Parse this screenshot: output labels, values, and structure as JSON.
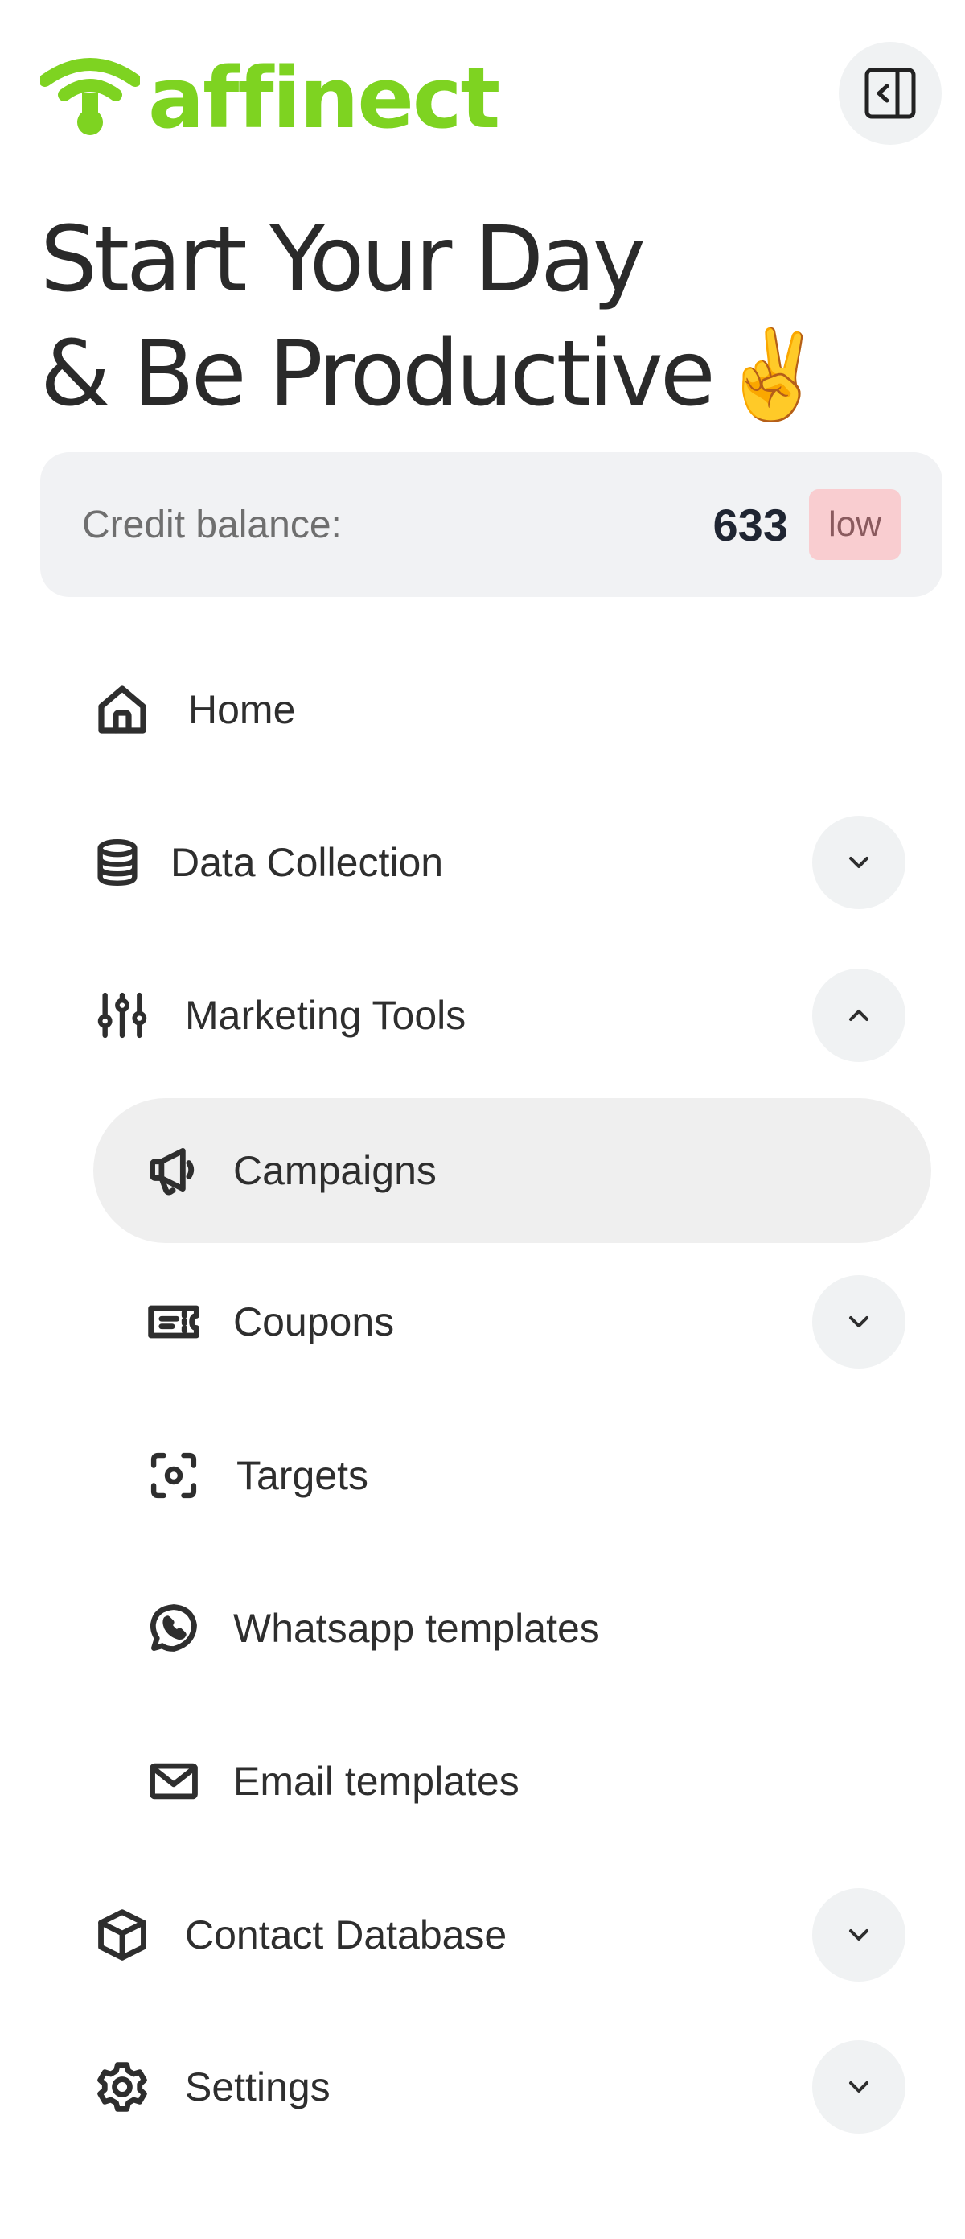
{
  "brand": {
    "name": "affinect",
    "color": "#7ed321"
  },
  "header": {
    "collapse_icon": "sidebar-collapse-icon"
  },
  "headline": {
    "line1": "Start Your Day",
    "line2": "& Be Productive",
    "emoji": "✌️"
  },
  "credit": {
    "label": "Credit balance:",
    "value": "633",
    "badge": "low",
    "badge_color": "#f9cdd0"
  },
  "nav": {
    "home": {
      "label": "Home",
      "icon": "home-icon"
    },
    "data_collection": {
      "label": "Data Collection",
      "icon": "database-icon",
      "expanded": false
    },
    "marketing_tools": {
      "label": "Marketing Tools",
      "icon": "sliders-icon",
      "expanded": true,
      "children": {
        "campaigns": {
          "label": "Campaigns",
          "icon": "megaphone-icon",
          "active": true
        },
        "coupons": {
          "label": "Coupons",
          "icon": "ticket-icon",
          "expanded": false
        },
        "targets": {
          "label": "Targets",
          "icon": "target-icon"
        },
        "whatsapp_templates": {
          "label": "Whatsapp templates",
          "icon": "whatsapp-icon"
        },
        "email_templates": {
          "label": "Email templates",
          "icon": "mail-icon"
        }
      }
    },
    "contact_database": {
      "label": "Contact Database",
      "icon": "cube-icon",
      "expanded": false
    },
    "settings": {
      "label": "Settings",
      "icon": "gear-icon",
      "expanded": false
    }
  },
  "colors": {
    "active_item_bg": "#efefef",
    "chevron_bg": "#f0f2f3",
    "credit_bg": "#f1f2f4"
  }
}
